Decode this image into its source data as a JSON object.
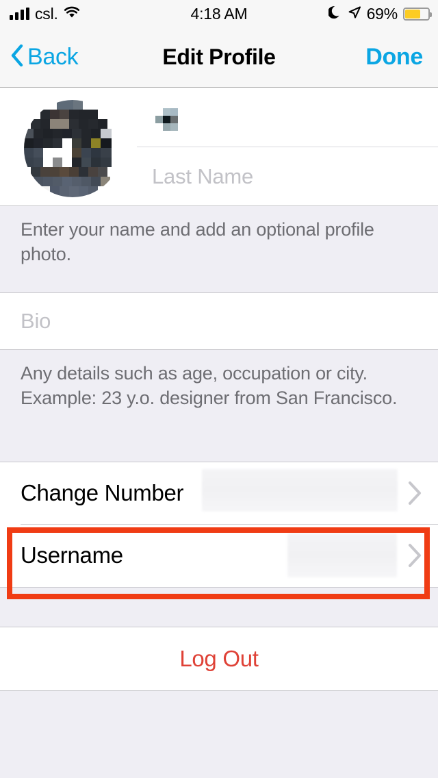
{
  "status_bar": {
    "carrier": "csl.",
    "time": "4:18 AM",
    "battery_percent": "69%",
    "battery_level": 69,
    "icons": [
      "signal-bars-icon",
      "wifi-icon",
      "moon-icon",
      "location-arrow-icon",
      "battery-icon"
    ],
    "battery_color": "#FCCC23"
  },
  "nav_bar": {
    "back_label": "Back",
    "title": "Edit Profile",
    "done_label": "Done",
    "accent_color": "#0BA6E3"
  },
  "name_section": {
    "avatar_alt": "profile-photo",
    "first_name_value": "",
    "first_name_placeholder": "",
    "last_name_value": "",
    "last_name_placeholder": "Last Name",
    "footer": "Enter your name and add an optional profile photo."
  },
  "bio_section": {
    "bio_value": "",
    "bio_placeholder": "Bio",
    "footer": "Any details such as age, occupation or city. Example: 23 y.o. designer from San Francisco."
  },
  "settings_rows": [
    {
      "label": "Change Number",
      "value": "",
      "accessory": "chevron-right-icon"
    },
    {
      "label": "Username",
      "value": "",
      "accessory": "chevron-right-icon"
    }
  ],
  "logout": {
    "label": "Log Out",
    "color": "#DF4237"
  },
  "annotation": {
    "target": "Username",
    "color": "#F03C14"
  }
}
